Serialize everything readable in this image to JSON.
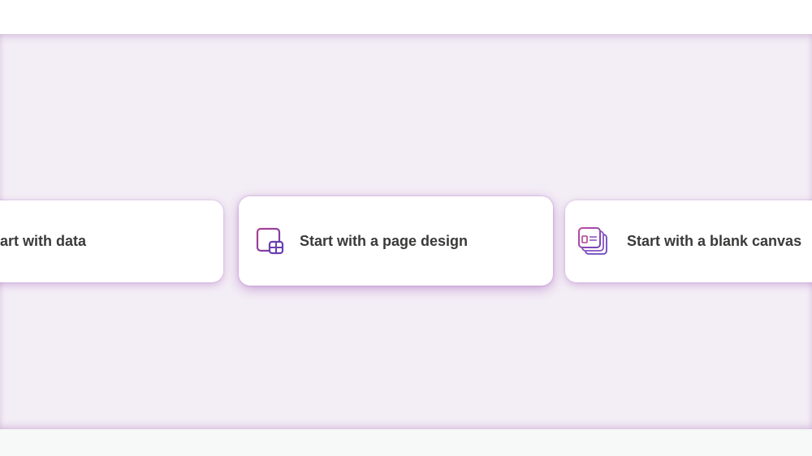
{
  "cards": [
    {
      "label": "art with data",
      "icon": "data-icon"
    },
    {
      "label": "Start with a page design",
      "icon": "page-design-icon"
    },
    {
      "label": "Start with a blank canvas",
      "icon": "blank-canvas-icon"
    }
  ],
  "colors": {
    "band_background": "#f3edf5",
    "card_background": "#ffffff",
    "label_text": "#3b3a39",
    "icon_purple": "#7b3fa8"
  }
}
